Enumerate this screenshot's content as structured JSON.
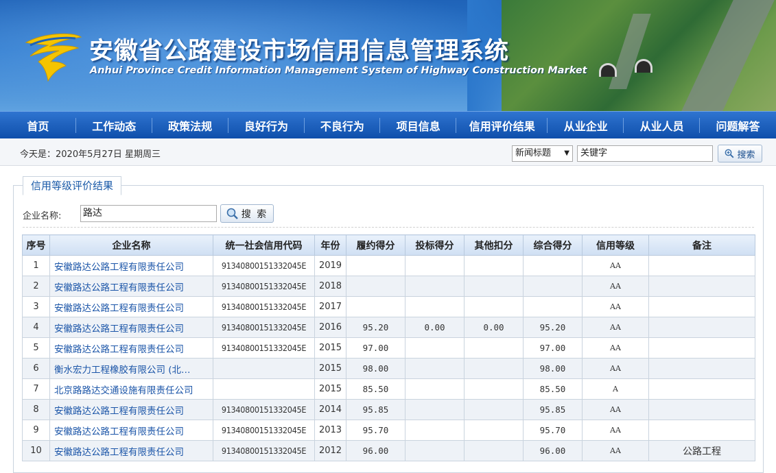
{
  "header": {
    "title_cn": "安徽省公路建设市场信用信息管理系统",
    "title_en": "Anhui Province Credit Information Management System of Highway Construction Market"
  },
  "nav": {
    "items": [
      "首页",
      "工作动态",
      "政策法规",
      "良好行为",
      "不良行为",
      "项目信息",
      "信用评价结果",
      "从业企业",
      "从业人员",
      "问题解答"
    ]
  },
  "toolbar": {
    "date_text": "今天是：2020年5月27日 星期周三",
    "search_type": "新闻标题",
    "keyword_value": "关键字",
    "search_label": "搜索"
  },
  "panel": {
    "tab_label": "信用等级评价结果",
    "corp_label": "企业名称:",
    "corp_value": "路达",
    "search_label": "搜 索"
  },
  "table": {
    "headers": [
      "序号",
      "企业名称",
      "统一社会信用代码",
      "年份",
      "履约得分",
      "投标得分",
      "其他扣分",
      "综合得分",
      "信用等级",
      "备注"
    ],
    "rows": [
      {
        "no": "1",
        "name": "安徽路达公路工程有限责任公司",
        "code": "91340800151332045E",
        "year": "2019",
        "perf": "",
        "bid": "",
        "other": "",
        "total": "",
        "grade": "AA",
        "note": ""
      },
      {
        "no": "2",
        "name": "安徽路达公路工程有限责任公司",
        "code": "91340800151332045E",
        "year": "2018",
        "perf": "",
        "bid": "",
        "other": "",
        "total": "",
        "grade": "AA",
        "note": ""
      },
      {
        "no": "3",
        "name": "安徽路达公路工程有限责任公司",
        "code": "91340800151332045E",
        "year": "2017",
        "perf": "",
        "bid": "",
        "other": "",
        "total": "",
        "grade": "AA",
        "note": ""
      },
      {
        "no": "4",
        "name": "安徽路达公路工程有限责任公司",
        "code": "91340800151332045E",
        "year": "2016",
        "perf": "95.20",
        "bid": "0.00",
        "other": "0.00",
        "total": "95.20",
        "grade": "AA",
        "note": ""
      },
      {
        "no": "5",
        "name": "安徽路达公路工程有限责任公司",
        "code": "91340800151332045E",
        "year": "2015",
        "perf": "97.00",
        "bid": "",
        "other": "",
        "total": "97.00",
        "grade": "AA",
        "note": ""
      },
      {
        "no": "6",
        "name": "衡水宏力工程橡胶有限公司 (北…",
        "code": "",
        "year": "2015",
        "perf": "98.00",
        "bid": "",
        "other": "",
        "total": "98.00",
        "grade": "AA",
        "note": ""
      },
      {
        "no": "7",
        "name": "北京路路达交通设施有限责任公司",
        "code": "",
        "year": "2015",
        "perf": "85.50",
        "bid": "",
        "other": "",
        "total": "85.50",
        "grade": "A",
        "note": ""
      },
      {
        "no": "8",
        "name": "安徽路达公路工程有限责任公司",
        "code": "91340800151332045E",
        "year": "2014",
        "perf": "95.85",
        "bid": "",
        "other": "",
        "total": "95.85",
        "grade": "AA",
        "note": ""
      },
      {
        "no": "9",
        "name": "安徽路达公路工程有限责任公司",
        "code": "91340800151332045E",
        "year": "2013",
        "perf": "95.70",
        "bid": "",
        "other": "",
        "total": "95.70",
        "grade": "AA",
        "note": ""
      },
      {
        "no": "10",
        "name": "安徽路达公路工程有限责任公司",
        "code": "91340800151332045E",
        "year": "2012",
        "perf": "96.00",
        "bid": "",
        "other": "",
        "total": "96.00",
        "grade": "AA",
        "note": "公路工程"
      }
    ]
  },
  "colors": {
    "nav_bg": "#0f4fab",
    "banner_bg": "#2c78cc",
    "link": "#1b55a8",
    "logo_yellow": "#f5c400"
  },
  "icons": {
    "logo": "highway-logo-icon",
    "search": "magnifier-icon"
  }
}
